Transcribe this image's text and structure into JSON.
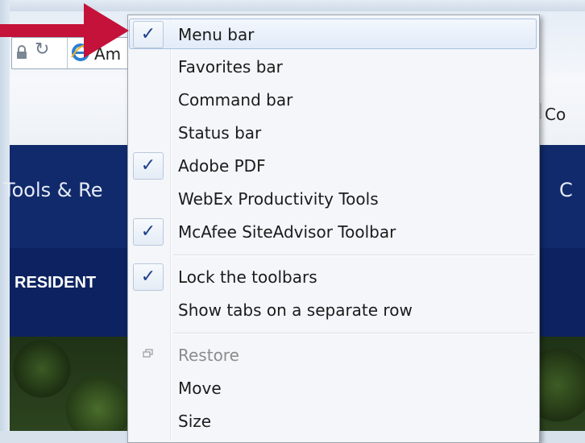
{
  "browser": {
    "address_tab_text": "Am",
    "command_bar_text": "Co",
    "banner_text": "Tools & Re",
    "banner_right_text": "C",
    "subnav_text": "RESIDENT"
  },
  "menu": {
    "items": [
      {
        "label": "Menu bar",
        "checked": true
      },
      {
        "label": "Favorites bar",
        "checked": false
      },
      {
        "label": "Command bar",
        "checked": false
      },
      {
        "label": "Status bar",
        "checked": false
      },
      {
        "label": "Adobe PDF",
        "checked": true
      },
      {
        "label": "WebEx Productivity Tools",
        "checked": false
      },
      {
        "label": "McAfee SiteAdvisor Toolbar",
        "checked": true
      },
      {
        "label": "Lock the toolbars",
        "checked": true
      },
      {
        "label": "Show tabs on a separate row",
        "checked": false
      },
      {
        "label": "Restore",
        "disabled": true
      },
      {
        "label": "Move",
        "disabled": false
      },
      {
        "label": "Size",
        "disabled": false
      }
    ],
    "check_glyph": "✓"
  },
  "colors": {
    "arrow": "#c4123a",
    "banner": "#112a6b",
    "check": "#1e3f8a"
  }
}
